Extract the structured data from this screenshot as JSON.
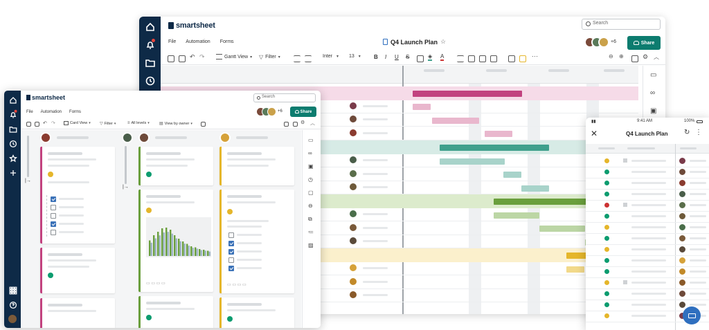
{
  "colors": {
    "sidebar": "#0e2a47",
    "brand_green": "#0c7c6f",
    "magenta": "#c2427f",
    "teal": "#3fa08c",
    "green": "#6a9f3d",
    "yellow": "#e5b62b",
    "red": "#cc3333"
  },
  "back_window": {
    "logo": "smartsheet",
    "menu": [
      "File",
      "Automation",
      "Forms"
    ],
    "title": "Q4 Launch Plan",
    "search_placeholder": "Search",
    "share_label": "Share",
    "collaborator_count": "+6",
    "toolbar": {
      "view": "Gantt View",
      "filter": "Filter",
      "font": "Inter",
      "font_size": "13"
    }
  },
  "front_window": {
    "logo": "smartsheet",
    "menu": [
      "File",
      "Automation",
      "Forms"
    ],
    "search_placeholder": "Search",
    "share_label": "Share",
    "collaborator_count": "+6",
    "toolbar": {
      "view": "Card View",
      "filter": "Filter",
      "levels": "All levels",
      "group": "View by owner"
    }
  },
  "mobile": {
    "time": "9:41 AM",
    "battery": "100%",
    "title": "Q4 Launch Plan"
  },
  "icons": {
    "sidebar": [
      "home-icon",
      "bell-icon",
      "folder-icon",
      "clock-icon",
      "star-icon",
      "plus-icon",
      "apps-icon",
      "help-icon"
    ],
    "right_panel": [
      "comment-icon",
      "link-icon",
      "attachment-icon",
      "activity-icon",
      "proof-icon",
      "summary-icon",
      "history-icon",
      "forms-icon",
      "image-icon"
    ]
  }
}
